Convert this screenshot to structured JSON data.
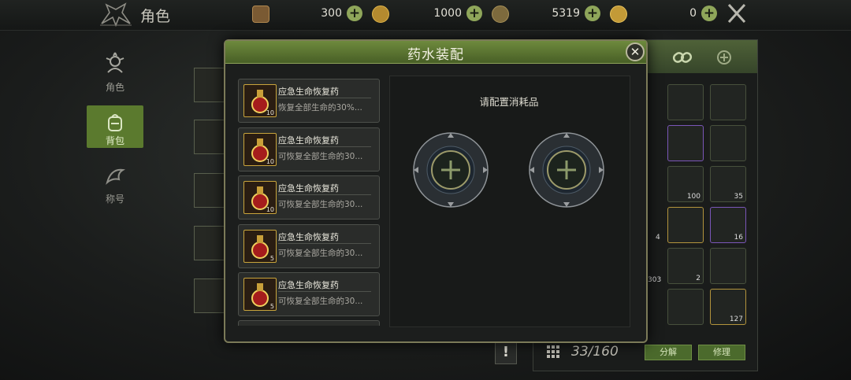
{
  "header": {
    "title": "角色",
    "resources": [
      {
        "icon": "ticket-icon",
        "value": "300"
      },
      {
        "icon": "swirl-coin-icon",
        "value": "1000"
      },
      {
        "icon": "coin-bag-icon",
        "value": "5319"
      },
      {
        "icon": "gold-coin-icon",
        "value": "0"
      }
    ]
  },
  "nav": [
    {
      "label": "角色",
      "icon": "character-icon"
    },
    {
      "label": "背包",
      "icon": "backpack-icon",
      "active": true
    },
    {
      "label": "称号",
      "icon": "title-badge-icon"
    }
  ],
  "modal": {
    "title": "药水装配",
    "prompt": "请配置消耗品",
    "items": [
      {
        "name": "应急生命恢复药",
        "desc": "恢复全部生命的30%...",
        "qty": "10"
      },
      {
        "name": "应急生命恢复药",
        "desc": "可恢复全部生命的30...",
        "qty": "10"
      },
      {
        "name": "应急生命恢复药",
        "desc": "可恢复全部生命的30...",
        "qty": "10"
      },
      {
        "name": "应急生命恢复药",
        "desc": "可恢复全部生命的30...",
        "qty": "5"
      },
      {
        "name": "应急生命恢复药",
        "desc": "可恢复全部生命的30...",
        "qty": "5"
      }
    ]
  },
  "inventory": {
    "count": "33/160",
    "decompose_label": "分解",
    "repair_label": "修理",
    "stack_counts": [
      "35",
      "4",
      "16",
      "303",
      "2",
      "100",
      "127"
    ]
  },
  "colors": {
    "accent_green": "#5b7a2e",
    "gold_border": "#c8a43c"
  }
}
